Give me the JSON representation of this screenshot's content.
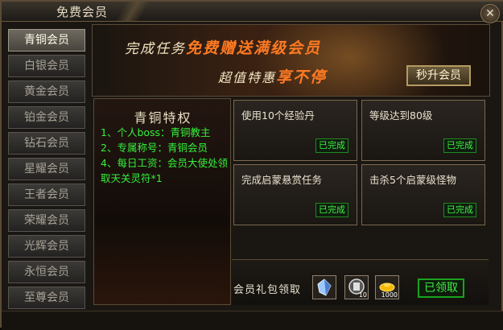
{
  "window": {
    "title": "免费会员",
    "close_glyph": "✕"
  },
  "sidebar": {
    "items": [
      {
        "label": "青铜会员",
        "active": true
      },
      {
        "label": "白银会员",
        "active": false
      },
      {
        "label": "黄金会员",
        "active": false
      },
      {
        "label": "铂金会员",
        "active": false
      },
      {
        "label": "钻石会员",
        "active": false
      },
      {
        "label": "星耀会员",
        "active": false
      },
      {
        "label": "王者会员",
        "active": false
      },
      {
        "label": "荣耀会员",
        "active": false
      },
      {
        "label": "光辉会员",
        "active": false
      },
      {
        "label": "永恒会员",
        "active": false
      },
      {
        "label": "至尊会员",
        "active": false
      }
    ]
  },
  "banner": {
    "line1_pre": "完成任务",
    "line1_hl": "免费赠送满级会员",
    "line2_pre": "超值特惠",
    "line2_hl": "享不停",
    "upgrade_button": "秒升会员"
  },
  "privileges": {
    "title": "青铜特权",
    "items": [
      "1、个人boss：青铜教主",
      "2、专属称号：青铜会员",
      "4、每日工资：会员大使处领取天关灵符*1"
    ]
  },
  "tasks": [
    {
      "name": "使用10个经验丹",
      "status": "已完成"
    },
    {
      "name": "等级达到80级",
      "status": "已完成"
    },
    {
      "name": "完成启蒙悬赏任务",
      "status": "已完成"
    },
    {
      "name": "击杀5个启蒙级怪物",
      "status": "已完成"
    }
  ],
  "reward": {
    "label": "会员礼包领取",
    "items": [
      {
        "icon": "crystal-icon",
        "count": ""
      },
      {
        "icon": "scroll-icon",
        "count": "10"
      },
      {
        "icon": "gold-ingot-icon",
        "count": "1000"
      }
    ],
    "claimed_button": "已领取"
  },
  "colors": {
    "accent": "#ff7a22",
    "done_green": "#3ff044",
    "frame": "#5a4b36"
  }
}
